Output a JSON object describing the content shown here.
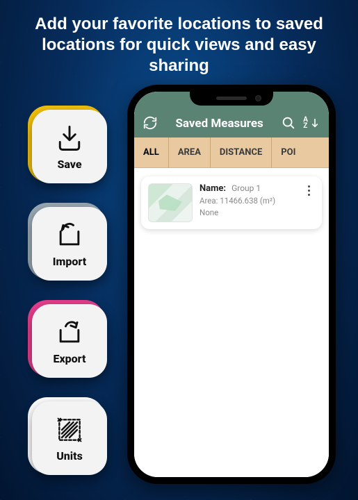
{
  "headline": "Add your favorite locations to saved locations for quick views and easy sharing",
  "features": {
    "save": {
      "label": "Save",
      "accent": "#f4c20d",
      "icon": "download-icon"
    },
    "import": {
      "label": "Import",
      "accent": "#9aa9b5",
      "icon": "import-icon"
    },
    "export": {
      "label": "Export",
      "accent": "#e83e8c",
      "icon": "export-icon"
    },
    "units": {
      "label": "Units",
      "accent": "#ffffff",
      "icon": "units-icon"
    }
  },
  "appbar": {
    "title": "Saved Measures",
    "refresh_name": "refresh-icon",
    "search_name": "search-icon",
    "sort_name": "sort-az-icon",
    "sort_az_a": "A",
    "sort_az_z": "Z"
  },
  "tabs": {
    "all": "ALL",
    "area": "AREA",
    "distance": "DISTANCE",
    "poi": "POI"
  },
  "item": {
    "name_label": "Name:",
    "name_value": "Group 1",
    "area_line": "Area: 11466.638 (m²)",
    "extra_line": "None"
  }
}
